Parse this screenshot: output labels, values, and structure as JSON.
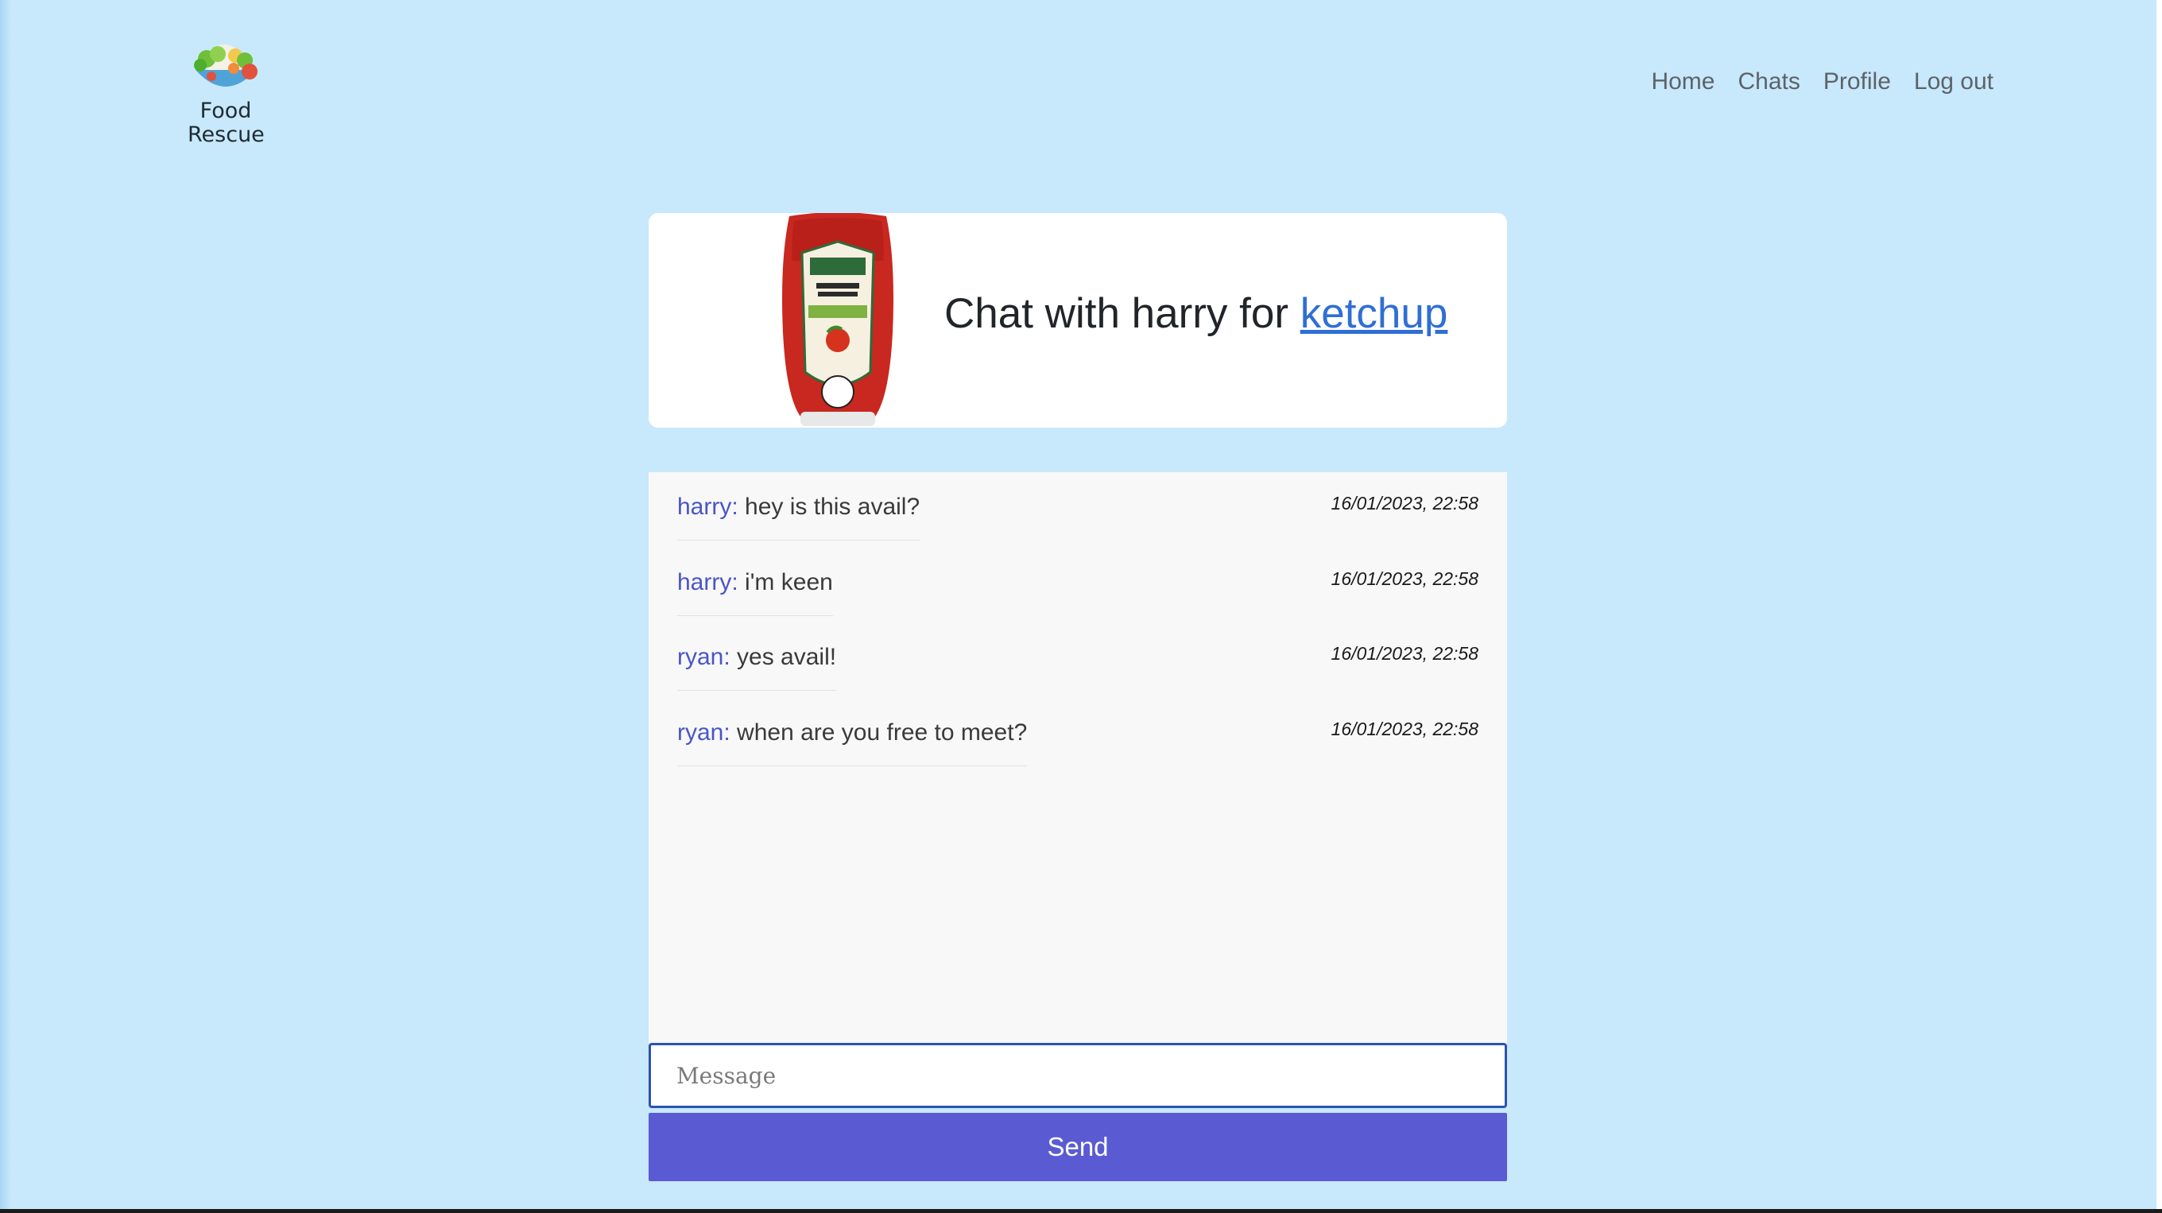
{
  "brand": {
    "logo_line1": "Food",
    "logo_line2": "Rescue",
    "logo_icon": "salad-bowl-icon"
  },
  "nav": {
    "home": "Home",
    "chats": "Chats",
    "profile": "Profile",
    "logout": "Log out"
  },
  "chat_header": {
    "title_prefix": "Chat with harry for ",
    "item_link": "ketchup",
    "product_image": "ketchup-bottle-image"
  },
  "messages": [
    {
      "sender": "harry",
      "separator": ":",
      "text": " hey is this avail?",
      "time": "16/01/2023, 22:58"
    },
    {
      "sender": "harry",
      "separator": ":",
      "text": " i'm keen",
      "time": "16/01/2023, 22:58"
    },
    {
      "sender": "ryan",
      "separator": ":",
      "text": " yes avail!",
      "time": "16/01/2023, 22:58"
    },
    {
      "sender": "ryan",
      "separator": ":",
      "text": " when are you free to meet?",
      "time": "16/01/2023, 22:58"
    }
  ],
  "composer": {
    "placeholder": "Message",
    "value": "",
    "send_label": "Send"
  },
  "colors": {
    "background": "#c8e8fb",
    "sender": "#4a55c7",
    "link": "#2f6ed6",
    "send_button": "#5a5bd3"
  }
}
